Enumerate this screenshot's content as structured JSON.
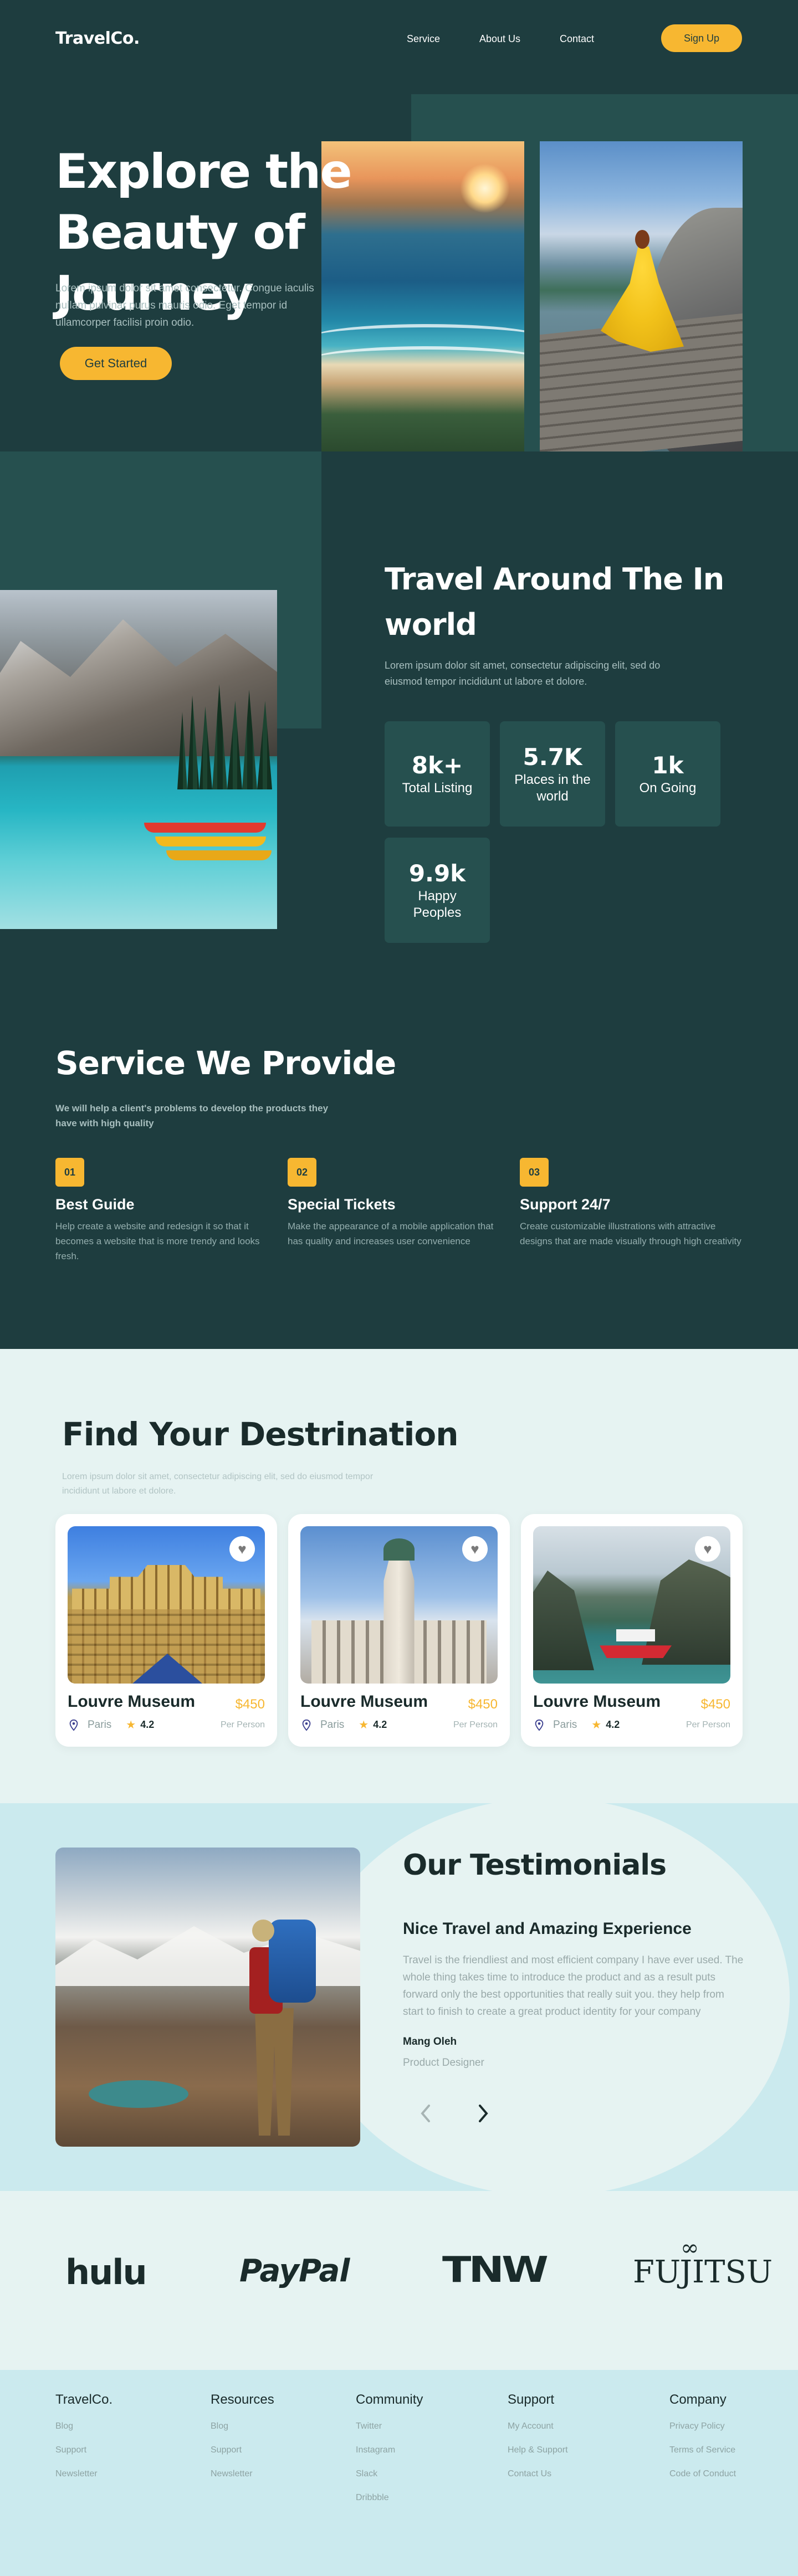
{
  "nav": {
    "logo": "TravelCo.",
    "links": [
      "Service",
      "About Us",
      "Contact"
    ],
    "signup": "Sign Up"
  },
  "hero": {
    "title": "Explore the Beauty of Journey",
    "description": "Lorem ipsum dolor sit amet consectetur. Congue iaculis nullam pulvinar purus mauris odio. Eget tempor id ullamcorper facilisi proin odio.",
    "cta": "Get Started"
  },
  "travel": {
    "title": "Travel Around The In world",
    "description": "Lorem ipsum dolor sit amet, consectetur adipiscing elit, sed do eiusmod tempor incididunt ut labore et dolore.",
    "stats": [
      {
        "value": "8k+",
        "label": "Total Listing"
      },
      {
        "value": "5.7K",
        "label": "Places in the world"
      },
      {
        "value": "1k",
        "label": "On Going"
      },
      {
        "value": "9.9k",
        "label": "Happy Peoples"
      }
    ]
  },
  "services": {
    "title": "Service We Provide",
    "subtitle": "We will help a client's problems to develop the products they have with high quality",
    "items": [
      {
        "num": "01",
        "title": "Best Guide",
        "desc": "Help create a website and redesign it so that it becomes a website that is more trendy and looks fresh."
      },
      {
        "num": "02",
        "title": "Special Tickets",
        "desc": "Make the appearance of a mobile application that has quality and increases user convenience"
      },
      {
        "num": "03",
        "title": "Support 24/7",
        "desc": "Create customizable illustrations with attractive designs that are made visually through high creativity"
      }
    ]
  },
  "destination": {
    "title": "Find Your Destrination",
    "description": "Lorem ipsum dolor sit amet, consectetur adipiscing elit, sed do eiusmod tempor incididunt ut labore et dolore.",
    "cards": [
      {
        "name": "Louvre Museum",
        "price": "$450",
        "per": "Per Person",
        "location": "Paris",
        "rating": "4.2"
      },
      {
        "name": "Louvre Museum",
        "price": "$450",
        "per": "Per Person",
        "location": "Paris",
        "rating": "4.2"
      },
      {
        "name": "Louvre Museum",
        "price": "$450",
        "per": "Per Person",
        "location": "Paris",
        "rating": "4.2"
      }
    ]
  },
  "testimonials": {
    "title": "Our Testimonials",
    "headline": "Nice Travel and Amazing Experience",
    "body": "Travel is the friendliest and most efficient company I have ever used. The whole thing takes time to introduce the product and as a result puts forward only the best opportunities that really suit you. they help from start to finish to create a great product identity for your company",
    "name": "Mang Oleh",
    "role": "Product Designer",
    "prev_icon": "chevron-left-icon",
    "next_icon": "chevron-right-icon"
  },
  "brands": [
    "hulu",
    "PayPal",
    "TNW",
    "FUJITSU"
  ],
  "footer": {
    "columns": [
      {
        "title": "TravelCo.",
        "links": [
          "Blog",
          "Support",
          "Newsletter"
        ]
      },
      {
        "title": "Resources",
        "links": [
          "Blog",
          "Support",
          "Newsletter"
        ]
      },
      {
        "title": "Community",
        "links": [
          "Twitter",
          "Instagram",
          "Slack",
          "Dribbble"
        ]
      },
      {
        "title": "Support",
        "links": [
          "My Account",
          "Help & Support",
          "Contact Us"
        ]
      },
      {
        "title": "Company",
        "links": [
          "Privacy Policy",
          "Terms of Service",
          "Code of Conduct"
        ]
      }
    ]
  },
  "colors": {
    "dark": "#1e3d3f",
    "panel": "#26504f",
    "accent": "#f7b731",
    "light_bg": "#e6f3f2",
    "cyan_bg": "#cbeaee"
  }
}
